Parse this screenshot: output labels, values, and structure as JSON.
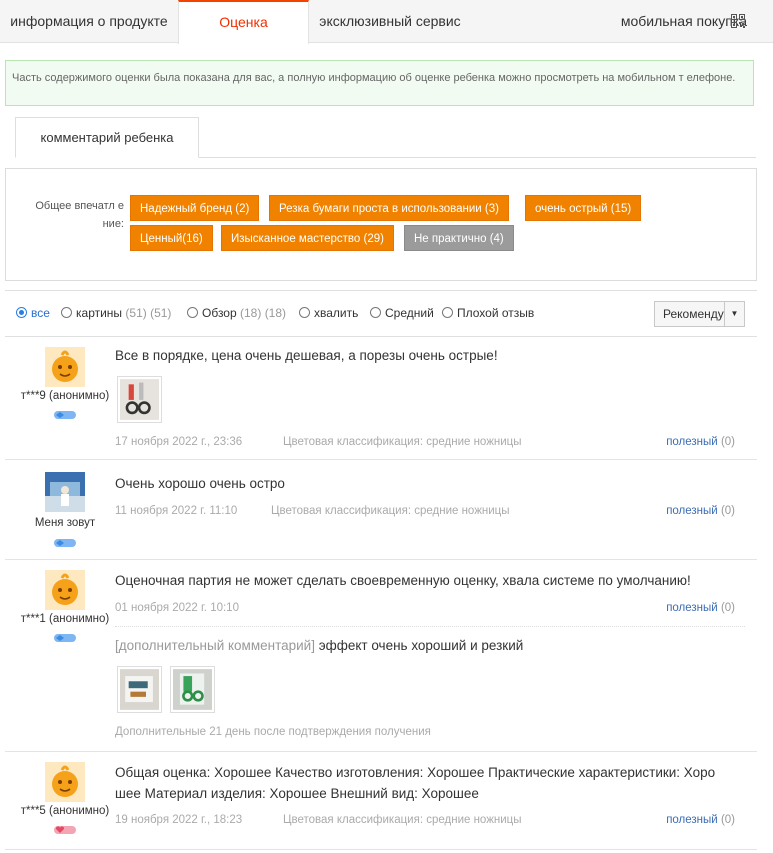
{
  "tabs": {
    "product_info": "информация о продукте",
    "reviews": "Оценка",
    "exclusive": "эксклюзивный сервис",
    "mobile": "мобильная покупка"
  },
  "notice": "Часть содержимого оценки была показана для вас, а полную информацию об оценке ребенка можно просмотреть на мобильном т елефоне.",
  "subtab": "комментарий ребенка",
  "impressions": {
    "label": "Общее впечатл ение:",
    "tags": [
      "Надежный бренд (2)",
      "Резка бумаги проста в использовании (3)",
      "очень острый (15)",
      "Ценный(16)",
      "Изысканное мастерство (29)",
      "Не практично (4)"
    ]
  },
  "filters": {
    "all": "все",
    "pictures": "картины",
    "pictures_count": "(51) (51)",
    "review": "Обзор",
    "review_count": "(18) (18)",
    "praise": "хвалить",
    "medium": "Средний",
    "bad": "Плохой отзыв",
    "sort": "Рекомендую"
  },
  "reviews": [
    {
      "user": "т***9 (анонимно)",
      "text": "Все в порядке, цена очень дешевая, а порезы очень острые!",
      "date": "17 ноября 2022 г., 23:36",
      "variant": "Цветовая классификация: средние ножницы",
      "useful": "полезный",
      "useful_count": "(0)"
    },
    {
      "user": "Меня зовут",
      "text": "Очень хорошо очень остро",
      "date": "11 ноября 2022 г. 11:10",
      "variant": "Цветовая классификация: средние ножницы",
      "useful": "полезный",
      "useful_count": "(0)"
    },
    {
      "user": "т***1 (анонимно)",
      "text": "Оценочная партия не может сделать своевременную оценку, хвала системе по умолчанию!",
      "date": "01 ноября 2022 г. 10:10",
      "useful": "полезный",
      "useful_count": "(0)",
      "additional_tag": "[дополнительный комментарий]",
      "additional_text": " эффект очень хороший и резкий",
      "additional_note": "Дополнительные 21 день после подтверждения получения"
    },
    {
      "user": "т***5 (анонимно)",
      "text": "Общая оценка: Хорошее Качество изготовления: Хорошее Практические характеристики: Хоро шее Материал изделия: Хорошее Внешний вид: Хорошее",
      "date": "19 ноября 2022 г., 18:23",
      "variant": "Цветовая классификация: средние ножницы",
      "useful": "полезный",
      "useful_count": "(0)"
    }
  ]
}
